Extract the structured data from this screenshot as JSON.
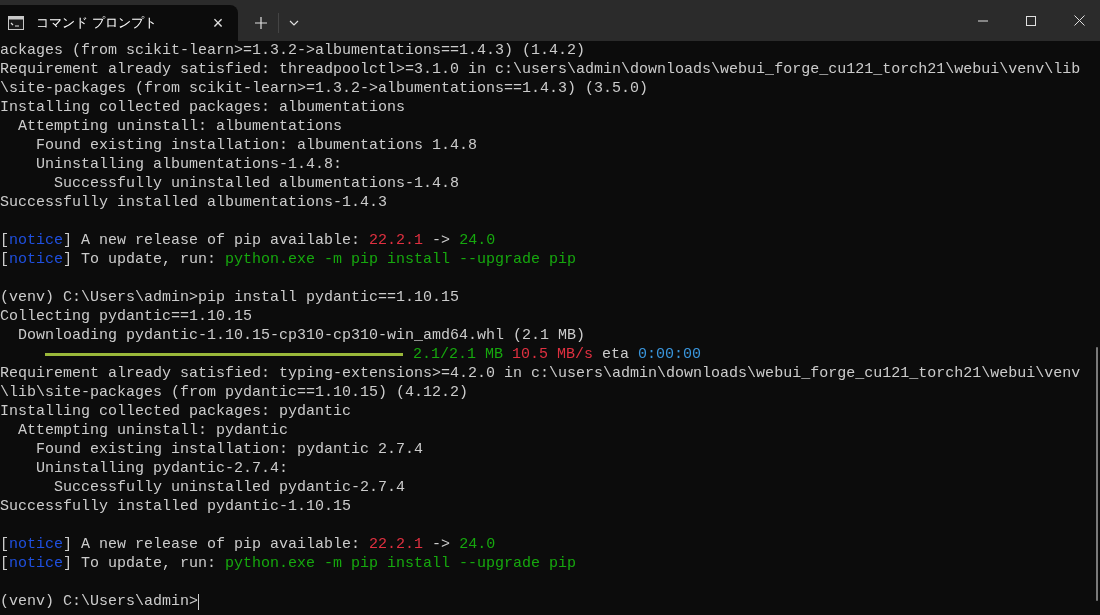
{
  "tab": {
    "title": "コマンド プロンプト",
    "close": "×"
  },
  "lines": [
    {
      "kind": "text",
      "segments": [
        {
          "kind": "plain",
          "text": "ackages (from scikit-learn>=1.3.2->albumentations==1.4.3) (1.4.2)"
        }
      ]
    },
    {
      "kind": "text",
      "segments": [
        {
          "kind": "plain",
          "text": "Requirement already satisfied: threadpoolctl>=3.1.0 in c:\\users\\admin\\downloads\\webui_forge_cu121_torch21\\webui\\venv\\lib"
        }
      ]
    },
    {
      "kind": "text",
      "segments": [
        {
          "kind": "plain",
          "text": "\\site-packages (from scikit-learn>=1.3.2->albumentations==1.4.3) (3.5.0)"
        }
      ]
    },
    {
      "kind": "text",
      "segments": [
        {
          "kind": "plain",
          "text": "Installing collected packages: albumentations"
        }
      ]
    },
    {
      "kind": "text",
      "segments": [
        {
          "kind": "plain",
          "text": "  Attempting uninstall: albumentations"
        }
      ]
    },
    {
      "kind": "text",
      "segments": [
        {
          "kind": "plain",
          "text": "    Found existing installation: albumentations 1.4.8"
        }
      ]
    },
    {
      "kind": "text",
      "segments": [
        {
          "kind": "plain",
          "text": "    Uninstalling albumentations-1.4.8:"
        }
      ]
    },
    {
      "kind": "text",
      "segments": [
        {
          "kind": "plain",
          "text": "      Successfully uninstalled albumentations-1.4.8"
        }
      ]
    },
    {
      "kind": "text",
      "segments": [
        {
          "kind": "plain",
          "text": "Successfully installed albumentations-1.4.3"
        }
      ]
    },
    {
      "kind": "blank"
    },
    {
      "kind": "text",
      "segments": [
        {
          "kind": "plain",
          "text": "["
        },
        {
          "kind": "notice",
          "text": "notice"
        },
        {
          "kind": "plain",
          "text": "] A new release of pip available: "
        },
        {
          "kind": "red",
          "text": "22.2.1"
        },
        {
          "kind": "plain",
          "text": " -> "
        },
        {
          "kind": "green",
          "text": "24.0"
        }
      ]
    },
    {
      "kind": "text",
      "segments": [
        {
          "kind": "plain",
          "text": "["
        },
        {
          "kind": "notice",
          "text": "notice"
        },
        {
          "kind": "plain",
          "text": "] To update, run: "
        },
        {
          "kind": "green",
          "text": "python.exe -m pip install --upgrade pip"
        }
      ]
    },
    {
      "kind": "blank"
    },
    {
      "kind": "text",
      "segments": [
        {
          "kind": "plain",
          "text": "(venv) C:\\Users\\admin>pip install pydantic==1.10.15"
        }
      ]
    },
    {
      "kind": "text",
      "segments": [
        {
          "kind": "plain",
          "text": "Collecting pydantic==1.10.15"
        }
      ]
    },
    {
      "kind": "text",
      "segments": [
        {
          "kind": "plain",
          "text": "  Downloading pydantic-1.10.15-cp310-cp310-win_amd64.whl (2.1 MB)"
        }
      ]
    },
    {
      "kind": "progress",
      "level": 1,
      "segments": [
        {
          "kind": "green",
          "text": "2.1/2.1 MB"
        },
        {
          "kind": "red",
          "text": "10.5 MB/s"
        },
        {
          "kind": "plain",
          "text": "eta"
        },
        {
          "kind": "cyan",
          "text": "0:00:00"
        }
      ]
    },
    {
      "kind": "text",
      "segments": [
        {
          "kind": "plain",
          "text": "Requirement already satisfied: typing-extensions>=4.2.0 in c:\\users\\admin\\downloads\\webui_forge_cu121_torch21\\webui\\venv"
        }
      ]
    },
    {
      "kind": "text",
      "segments": [
        {
          "kind": "plain",
          "text": "\\lib\\site-packages (from pydantic==1.10.15) (4.12.2)"
        }
      ]
    },
    {
      "kind": "text",
      "segments": [
        {
          "kind": "plain",
          "text": "Installing collected packages: pydantic"
        }
      ]
    },
    {
      "kind": "text",
      "segments": [
        {
          "kind": "plain",
          "text": "  Attempting uninstall: pydantic"
        }
      ]
    },
    {
      "kind": "text",
      "segments": [
        {
          "kind": "plain",
          "text": "    Found existing installation: pydantic 2.7.4"
        }
      ]
    },
    {
      "kind": "text",
      "segments": [
        {
          "kind": "plain",
          "text": "    Uninstalling pydantic-2.7.4:"
        }
      ]
    },
    {
      "kind": "text",
      "segments": [
        {
          "kind": "plain",
          "text": "      Successfully uninstalled pydantic-2.7.4"
        }
      ]
    },
    {
      "kind": "text",
      "segments": [
        {
          "kind": "plain",
          "text": "Successfully installed pydantic-1.10.15"
        }
      ]
    },
    {
      "kind": "blank"
    },
    {
      "kind": "text",
      "segments": [
        {
          "kind": "plain",
          "text": "["
        },
        {
          "kind": "notice",
          "text": "notice"
        },
        {
          "kind": "plain",
          "text": "] A new release of pip available: "
        },
        {
          "kind": "red",
          "text": "22.2.1"
        },
        {
          "kind": "plain",
          "text": " -> "
        },
        {
          "kind": "green",
          "text": "24.0"
        }
      ]
    },
    {
      "kind": "text",
      "segments": [
        {
          "kind": "plain",
          "text": "["
        },
        {
          "kind": "notice",
          "text": "notice"
        },
        {
          "kind": "plain",
          "text": "] To update, run: "
        },
        {
          "kind": "green",
          "text": "python.exe -m pip install --upgrade pip"
        }
      ]
    },
    {
      "kind": "blank"
    },
    {
      "kind": "prompt",
      "segments": [
        {
          "kind": "plain",
          "text": "(venv) C:\\Users\\admin>"
        }
      ]
    }
  ]
}
